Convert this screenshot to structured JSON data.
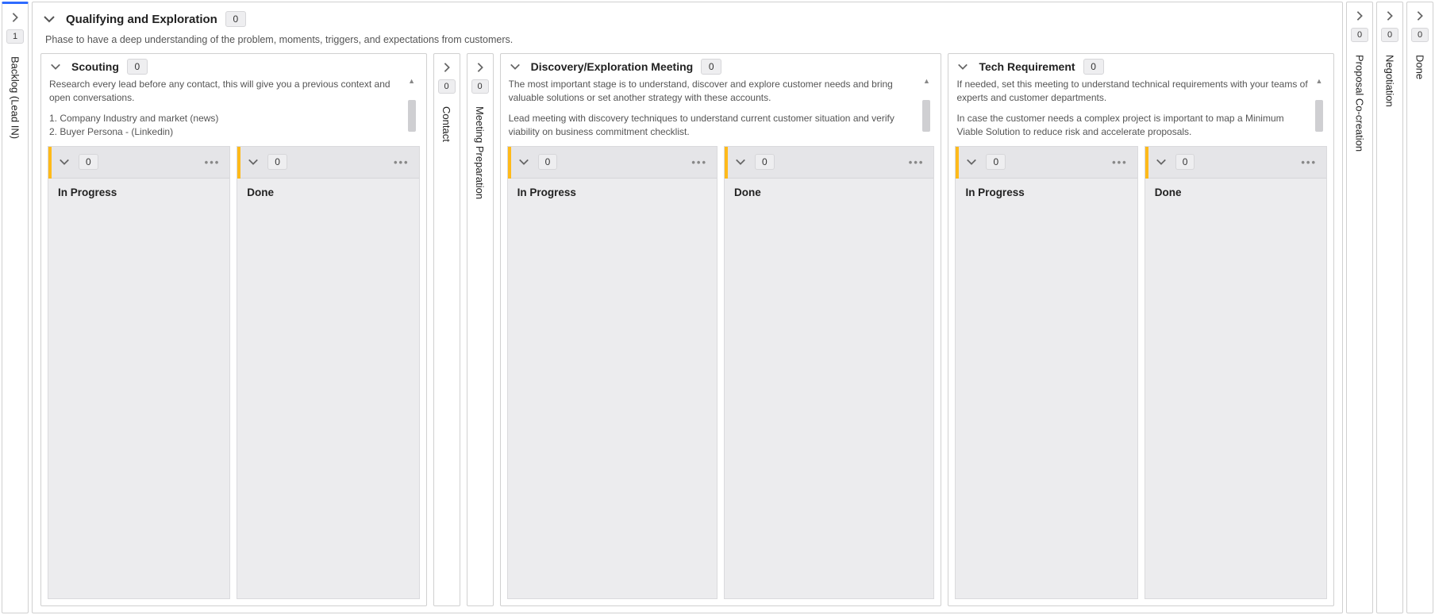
{
  "collapsed_left": {
    "backlog": {
      "label": "Backlog (Lead IN)",
      "count": 1
    }
  },
  "main": {
    "title": "Qualifying and Exploration",
    "count": 0,
    "description": "Phase to have a deep understanding of the problem, moments, triggers, and expectations from customers.",
    "stages": {
      "scouting": {
        "title": "Scouting",
        "count": 0,
        "desc_p1": "Research every lead before any contact, this will give you a previous context and open conversations.",
        "desc_li1": "1. Company Industry and market (news)",
        "desc_li2": "2. Buyer Persona - (Linkedin)",
        "lanes": [
          {
            "title": "In Progress",
            "count": 0
          },
          {
            "title": "Done",
            "count": 0
          }
        ]
      },
      "contact": {
        "label": "Contact",
        "count": 0
      },
      "meetingprep": {
        "label": "Meeting Preparation",
        "count": 0
      },
      "discovery": {
        "title": "Discovery/Exploration Meeting",
        "count": 0,
        "desc_p1": "The most important stage is to understand, discover and explore customer needs and bring valuable solutions or set another strategy with these accounts.",
        "desc_p2": "Lead meeting with discovery techniques to understand current customer situation and verify viability on business commitment checklist.",
        "lanes": [
          {
            "title": "In Progress",
            "count": 0
          },
          {
            "title": "Done",
            "count": 0
          }
        ]
      },
      "techreq": {
        "title": "Tech Requirement",
        "count": 0,
        "desc_p1": "If needed, set this meeting to understand technical requirements with your teams of experts and customer departments.",
        "desc_p2": "In case the customer needs a complex project is important to map a Minimum Viable Solution to reduce risk and accelerate proposals.",
        "lanes": [
          {
            "title": "In Progress",
            "count": 0
          },
          {
            "title": "Done",
            "count": 0
          }
        ]
      }
    }
  },
  "collapsed_right": {
    "proposal": {
      "label": "Proposal Co-creation",
      "count": 0
    },
    "negotiation": {
      "label": "Negotiation",
      "count": 0
    },
    "done": {
      "label": "Done",
      "count": 0
    }
  }
}
